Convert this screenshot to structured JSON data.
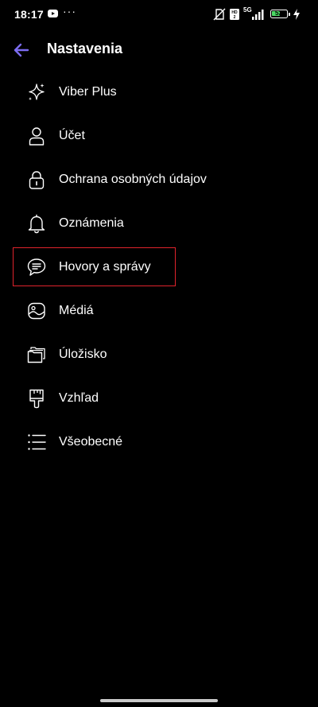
{
  "status_bar": {
    "time": "18:17",
    "more": "···",
    "network": "5G",
    "battery_level": "53",
    "icons": [
      "youtube-icon",
      "more-icon",
      "no-sim-icon",
      "volte-icon",
      "network-5g-icon",
      "signal-icon",
      "battery-icon",
      "charging-icon"
    ]
  },
  "header": {
    "title": "Nastavenia",
    "back_icon": "arrow-left-icon",
    "accent_color": "#7c6cf0"
  },
  "menu": {
    "items": [
      {
        "label": "Viber Plus",
        "icon": "sparkle-icon"
      },
      {
        "label": "Účet",
        "icon": "user-icon"
      },
      {
        "label": "Ochrana osobných údajov",
        "icon": "lock-icon"
      },
      {
        "label": "Oznámenia",
        "icon": "bell-icon"
      },
      {
        "label": "Hovory a správy",
        "icon": "message-icon",
        "highlighted": true
      },
      {
        "label": "Médiá",
        "icon": "image-icon"
      },
      {
        "label": "Úložisko",
        "icon": "folders-icon"
      },
      {
        "label": "Vzhľad",
        "icon": "brush-icon"
      },
      {
        "label": "Všeobecné",
        "icon": "list-icon"
      }
    ]
  },
  "colors": {
    "background": "#000000",
    "text": "#ffffff",
    "highlight_border": "#e0232c"
  }
}
